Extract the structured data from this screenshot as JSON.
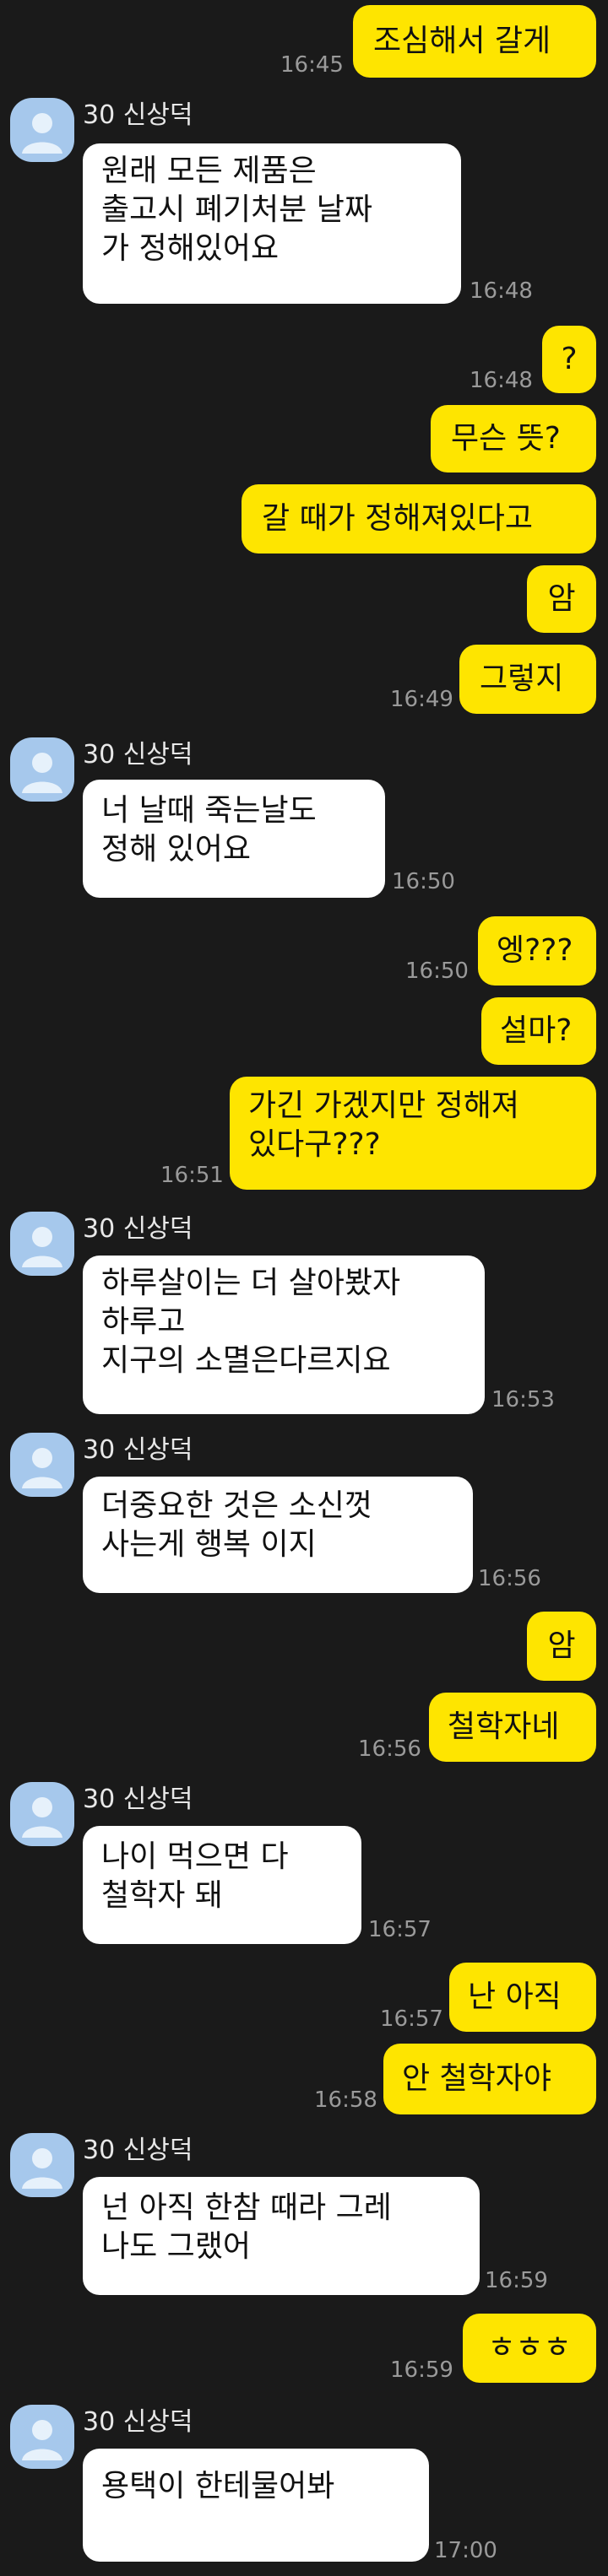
{
  "sender_name": "30 신상덕",
  "messages": [
    {
      "text": "조심해서 갈게",
      "time": "16:45"
    },
    {
      "text": "원래 모든 제품은\n출고시 폐기처분 날짜\n가 정해있어요",
      "time": "16:48"
    },
    {
      "text": "?",
      "time": "16:48"
    },
    {
      "text": "무슨 뜻?",
      "time": ""
    },
    {
      "text": "갈 때가 정해져있다고",
      "time": ""
    },
    {
      "text": "암",
      "time": ""
    },
    {
      "text": "그렇지",
      "time": "16:49"
    },
    {
      "text": "너 날때 죽는날도\n정해 있어요",
      "time": "16:50"
    },
    {
      "text": "엥???",
      "time": "16:50"
    },
    {
      "text": "설마?",
      "time": ""
    },
    {
      "text": "가긴 가겠지만 정해져\n있다구???",
      "time": "16:51"
    },
    {
      "text": "하루살이는 더 살아봤자\n하루고\n지구의 소멸은다르지요",
      "time": "16:53"
    },
    {
      "text": "더중요한  것은 소신껏\n사는게  행복  이지",
      "time": "16:56"
    },
    {
      "text": "암",
      "time": ""
    },
    {
      "text": "철학자네",
      "time": "16:56"
    },
    {
      "text": "나이 먹으면 다\n철학자 돼",
      "time": "16:57"
    },
    {
      "text": "난 아직",
      "time": "16:57"
    },
    {
      "text": "안 철학자야",
      "time": "16:58"
    },
    {
      "text": "넌 아직 한참 때라 그레\n나도 그랬어",
      "time": "16:59"
    },
    {
      "text": "ㅎㅎㅎ",
      "time": "16:59"
    },
    {
      "text": "용택이  한테물어봐",
      "time": "17:00"
    }
  ],
  "colors": {
    "background": "#1a1a1a",
    "outgoing_bubble": "#fee500",
    "incoming_bubble": "#ffffff",
    "timestamp": "#9a9a9a",
    "avatar": "#a6c8ec"
  },
  "icons": {
    "avatar": "default-profile-icon"
  }
}
